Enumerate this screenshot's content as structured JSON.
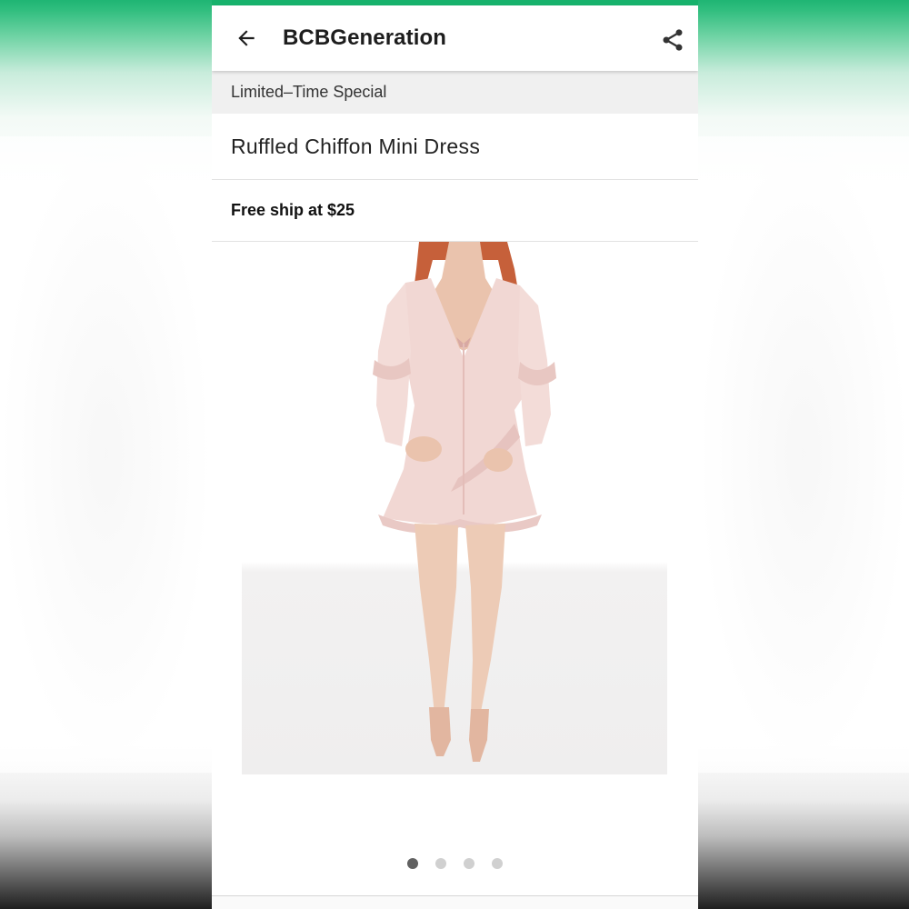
{
  "appbar": {
    "title": "BCBGeneration",
    "back_icon": "arrow-left-icon",
    "share_icon": "share-icon"
  },
  "promo": {
    "text": "Limited–Time Special"
  },
  "product": {
    "title": "Ruffled Chiffon Mini Dress",
    "shipping": "Free ship at $25"
  },
  "gallery": {
    "image_alt": "model wearing blush pink ruffled chiffon mini dress",
    "total_images": 4,
    "active_index": 0
  },
  "colors": {
    "accent": "#17b26c",
    "dress": "#f1d7d3",
    "skin": "#ecc4ae",
    "hair": "#c6603a"
  }
}
